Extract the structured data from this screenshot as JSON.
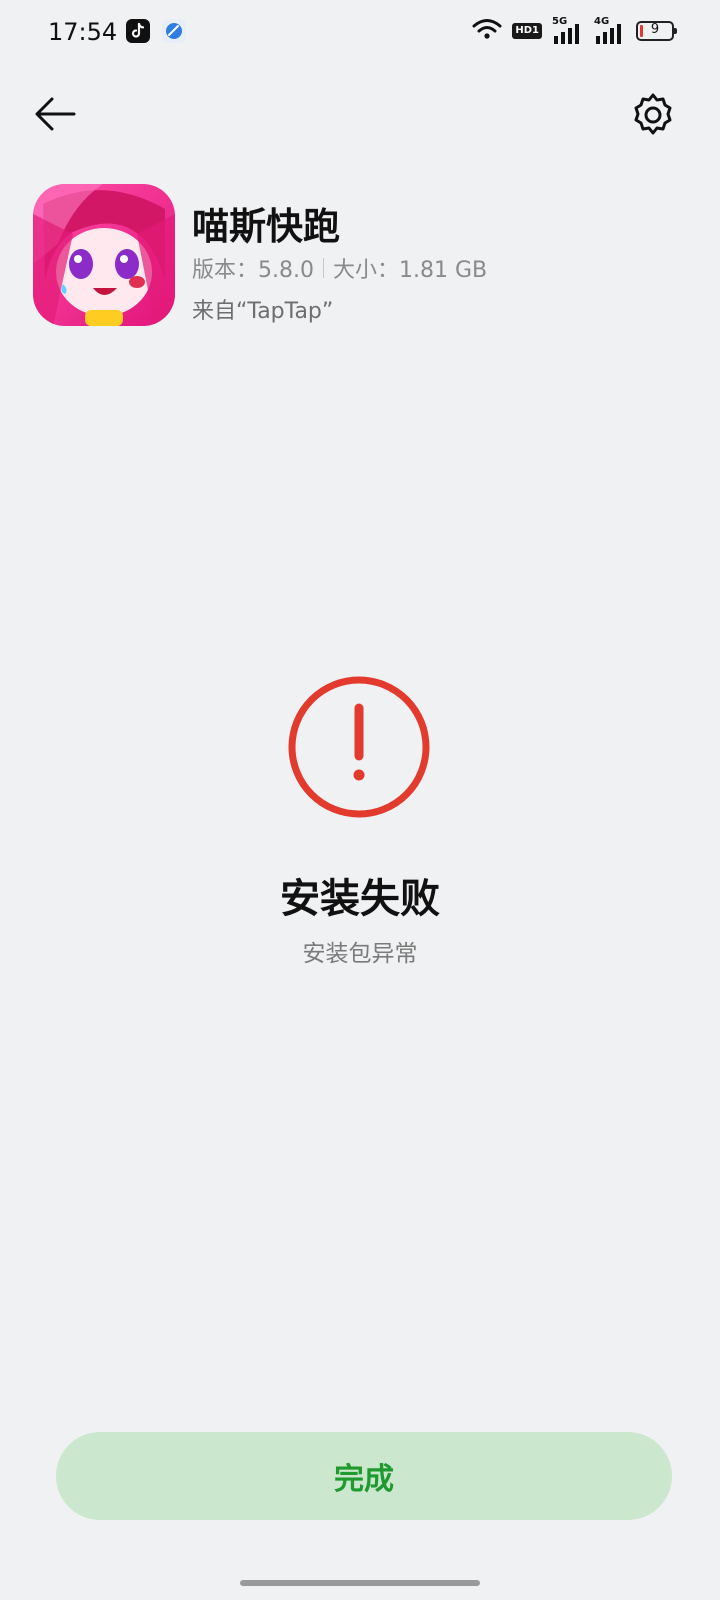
{
  "status_bar": {
    "time": "17:54",
    "notification_icons": [
      "tiktok-icon",
      "browser-app-icon"
    ],
    "hd_badge": "HD1",
    "signal_1_tag": "5G",
    "signal_2_tag": "4G",
    "battery_level": "9",
    "battery_color": "#e53935"
  },
  "header": {
    "back_icon": "arrow-left-icon",
    "settings_icon": "gear-icon"
  },
  "app": {
    "name": "喵斯快跑",
    "version_label": "版本：5.8.0",
    "size_label": "大小：1.81 GB",
    "source": "来自“TapTap”"
  },
  "result": {
    "icon": "exclamation-circle-icon",
    "icon_color": "#e23b2e",
    "title": "安装失败",
    "subtitle": "安装包异常"
  },
  "footer": {
    "done_label": "完成",
    "accent_color": "#1f9a2e"
  }
}
